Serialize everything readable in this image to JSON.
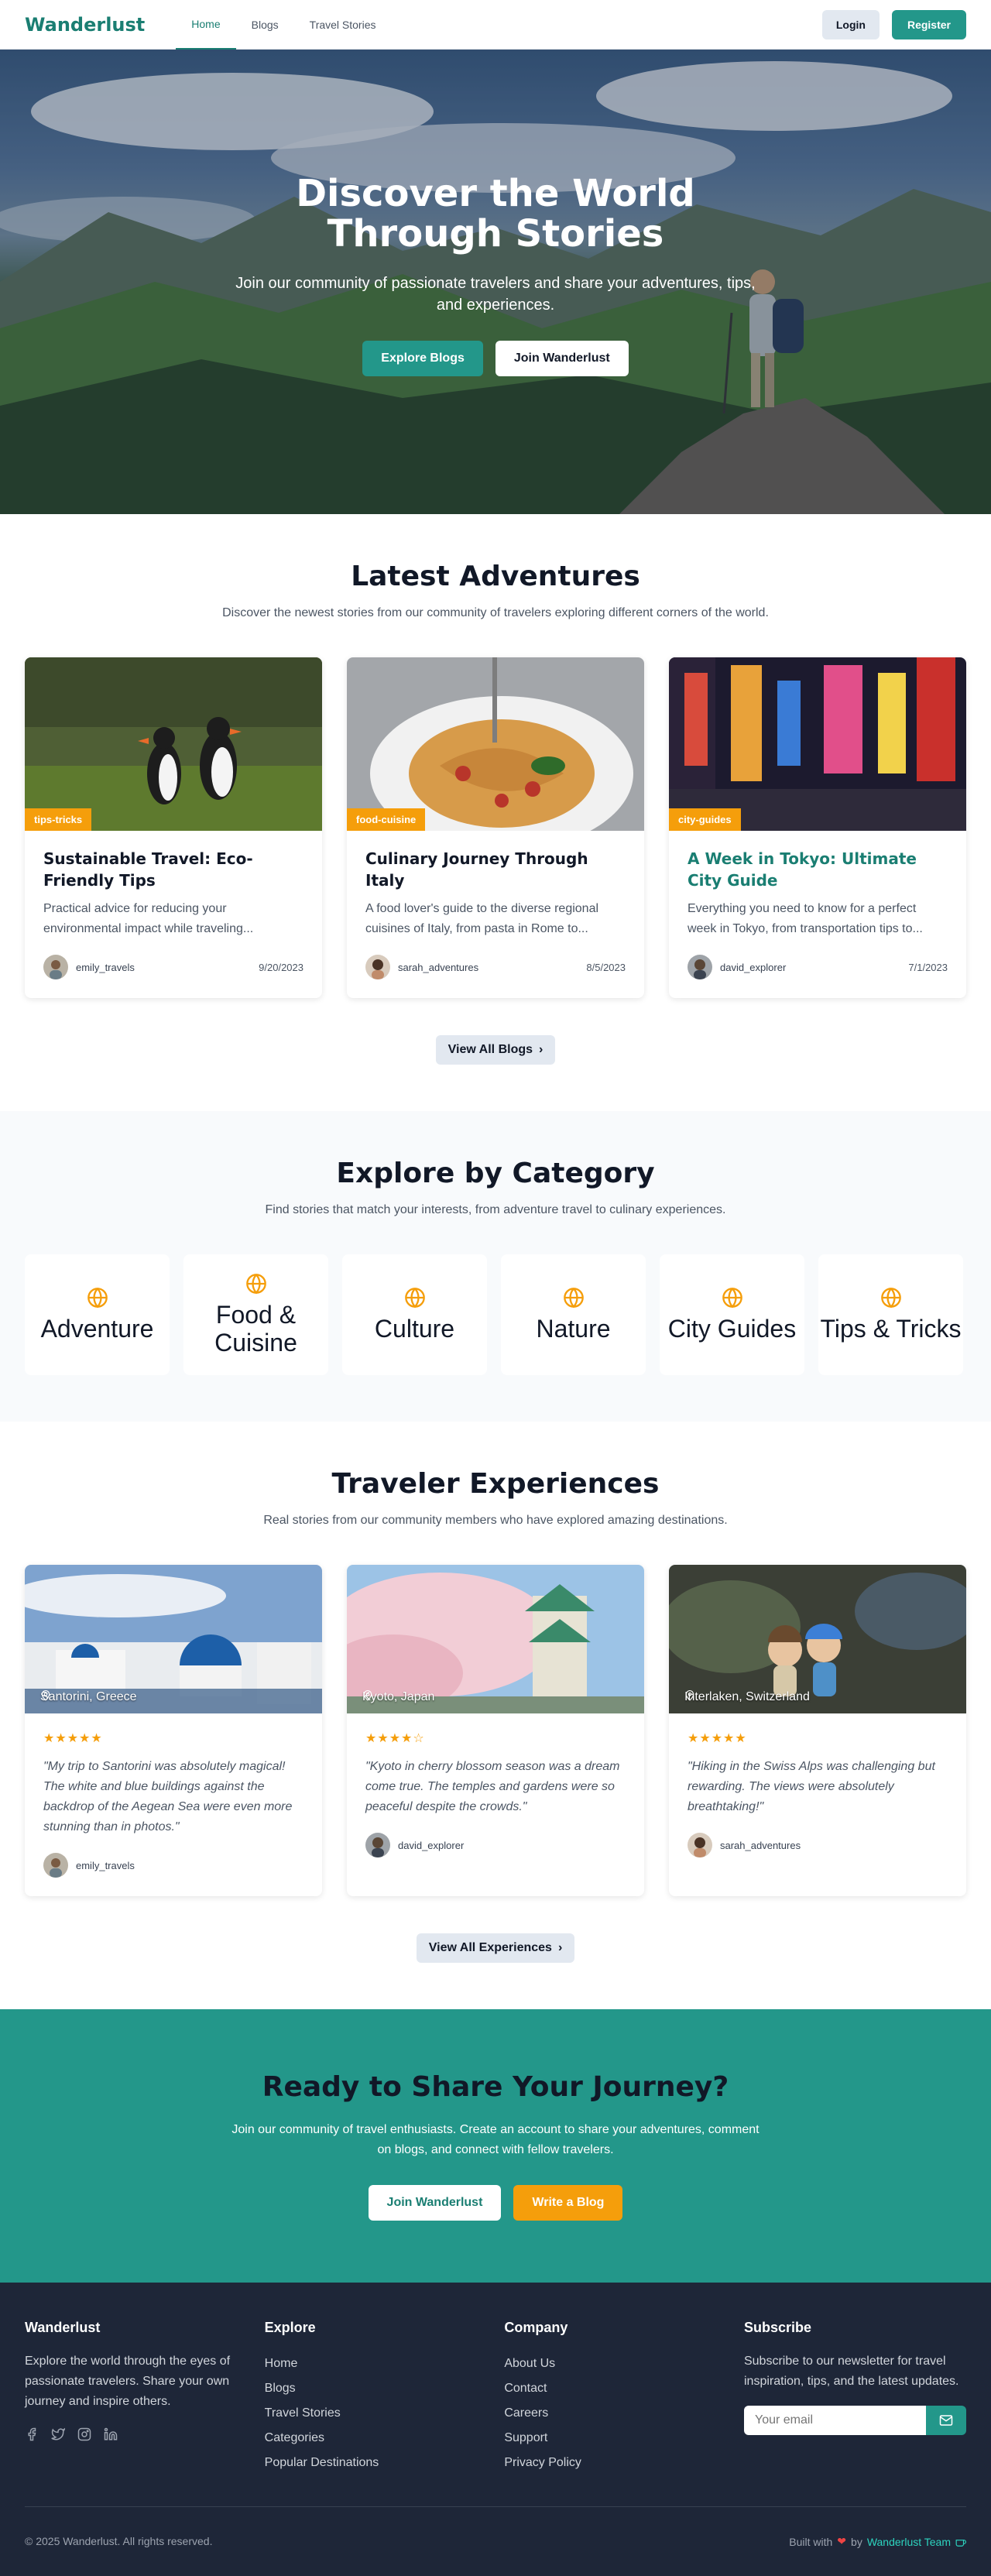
{
  "nav": {
    "brand": "Wanderlust",
    "links": [
      "Home",
      "Blogs",
      "Travel Stories"
    ],
    "login": "Login",
    "register": "Register"
  },
  "hero": {
    "title": "Discover the World Through Stories",
    "subtitle": "Join our community of passionate travelers and share your adventures, tips, and experiences.",
    "explore_btn": "Explore Blogs",
    "join_btn": "Join Wanderlust"
  },
  "latest": {
    "title": "Latest Adventures",
    "subtitle": "Discover the newest stories from our community of travelers exploring different corners of the world.",
    "posts": [
      {
        "tag": "tips-tricks",
        "title": "Sustainable Travel: Eco-Friendly Tips",
        "excerpt": "Practical advice for reducing your environmental impact while traveling...",
        "author": "emily_travels",
        "date": "9/20/2023"
      },
      {
        "tag": "food-cuisine",
        "title": "Culinary Journey Through Italy",
        "excerpt": "A food lover's guide to the diverse regional cuisines of Italy, from pasta in Rome to...",
        "author": "sarah_adventures",
        "date": "8/5/2023"
      },
      {
        "tag": "city-guides",
        "title": "A Week in Tokyo: Ultimate City Guide",
        "excerpt": "Everything you need to know for a perfect week in Tokyo, from transportation tips to...",
        "author": "david_explorer",
        "date": "7/1/2023"
      }
    ],
    "view_all": "View All Blogs"
  },
  "categories": {
    "title": "Explore by Category",
    "subtitle": "Find stories that match your interests, from adventure travel to culinary experiences.",
    "items": [
      "Adventure",
      "Food & Cuisine",
      "Culture",
      "Nature",
      "City Guides",
      "Tips & Tricks"
    ]
  },
  "experiences": {
    "title": "Traveler Experiences",
    "subtitle": "Real stories from our community members who have explored amazing destinations.",
    "items": [
      {
        "location": "Santorini, Greece",
        "rating": 5,
        "stars": "★★★★★",
        "quote": "\"My trip to Santorini was absolutely magical! The white and blue buildings against the backdrop of the Aegean Sea were even more stunning than in photos.\"",
        "author": "emily_travels"
      },
      {
        "location": "Kyoto, Japan",
        "rating": 4,
        "stars": "★★★★☆",
        "quote": "\"Kyoto in cherry blossom season was a dream come true. The temples and gardens were so peaceful despite the crowds.\"",
        "author": "david_explorer"
      },
      {
        "location": "Interlaken, Switzerland",
        "rating": 5,
        "stars": "★★★★★",
        "quote": "\"Hiking in the Swiss Alps was challenging but rewarding. The views were absolutely breathtaking!\"",
        "author": "sarah_adventures"
      }
    ],
    "view_all": "View All Experiences"
  },
  "cta": {
    "title": "Ready to Share Your Journey?",
    "text": "Join our community of travel enthusiasts. Create an account to share your adventures, comment on blogs, and connect with fellow travelers.",
    "join_btn": "Join Wanderlust",
    "write_btn": "Write a Blog"
  },
  "footer": {
    "brand": "Wanderlust",
    "about": "Explore the world through the eyes of passionate travelers. Share your own journey and inspire others.",
    "explore_title": "Explore",
    "explore_links": [
      "Home",
      "Blogs",
      "Travel Stories",
      "Categories",
      "Popular Destinations"
    ],
    "company_title": "Company",
    "company_links": [
      "About Us",
      "Contact",
      "Careers",
      "Support",
      "Privacy Policy"
    ],
    "subscribe_title": "Subscribe",
    "subscribe_text": "Subscribe to our newsletter for travel inspiration, tips, and the latest updates.",
    "email_placeholder": "Your email",
    "copyright": "© 2025 Wanderlust. All rights reserved.",
    "built_with": "Built with",
    "by": "by",
    "team": "Wanderlust Team"
  },
  "icons": {
    "category": "globe-icon",
    "location": "map-pin-icon",
    "social": [
      "facebook-icon",
      "twitter-icon",
      "instagram-icon",
      "linkedin-icon"
    ],
    "subscribe": "mail-icon"
  },
  "colors": {
    "brand": "#23978a",
    "accent": "#f59e0b",
    "footer_bg": "#1e2638"
  }
}
